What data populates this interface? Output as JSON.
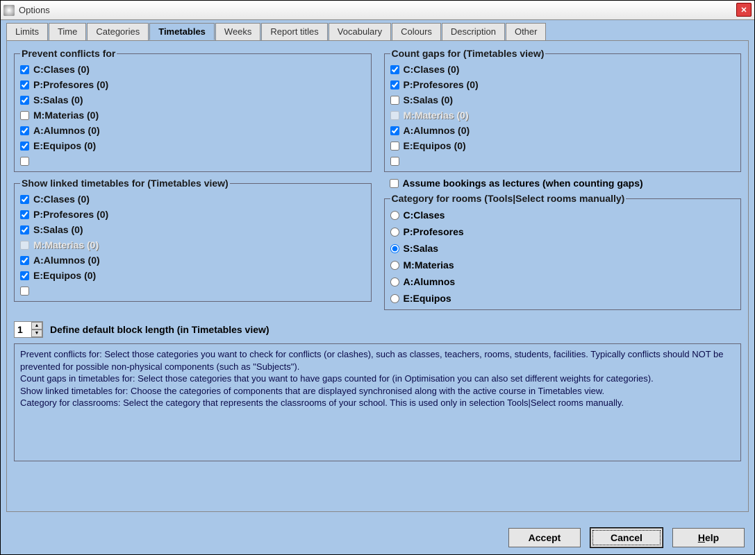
{
  "window": {
    "title": "Options"
  },
  "tabs": [
    "Limits",
    "Time",
    "Categories",
    "Timetables",
    "Weeks",
    "Report titles",
    "Vocabulary",
    "Colours",
    "Description",
    "Other"
  ],
  "active_tab": "Timetables",
  "groups": {
    "prevent": {
      "legend": "Prevent conflicts for",
      "items": [
        {
          "label": "C:Clases (0)",
          "checked": true,
          "disabled": false
        },
        {
          "label": "P:Profesores (0)",
          "checked": true,
          "disabled": false
        },
        {
          "label": "S:Salas (0)",
          "checked": true,
          "disabled": false
        },
        {
          "label": "M:Materias (0)",
          "checked": false,
          "disabled": false
        },
        {
          "label": "A:Alumnos (0)",
          "checked": true,
          "disabled": false
        },
        {
          "label": "E:Equipos (0)",
          "checked": true,
          "disabled": false
        },
        {
          "label": "",
          "checked": false,
          "disabled": false
        }
      ]
    },
    "show_linked": {
      "legend": "Show linked timetables for (Timetables view)",
      "items": [
        {
          "label": "C:Clases (0)",
          "checked": true,
          "disabled": false
        },
        {
          "label": "P:Profesores (0)",
          "checked": true,
          "disabled": false
        },
        {
          "label": "S:Salas (0)",
          "checked": true,
          "disabled": false
        },
        {
          "label": "M:Materias (0)",
          "checked": false,
          "disabled": true
        },
        {
          "label": "A:Alumnos (0)",
          "checked": true,
          "disabled": false
        },
        {
          "label": "E:Equipos (0)",
          "checked": true,
          "disabled": false
        },
        {
          "label": "",
          "checked": false,
          "disabled": false
        }
      ]
    },
    "count_gaps": {
      "legend": "Count gaps for (Timetables view)",
      "items": [
        {
          "label": "C:Clases (0)",
          "checked": true,
          "disabled": false
        },
        {
          "label": "P:Profesores (0)",
          "checked": true,
          "disabled": false
        },
        {
          "label": "S:Salas (0)",
          "checked": false,
          "disabled": false
        },
        {
          "label": "M:Materias (0)",
          "checked": false,
          "disabled": true
        },
        {
          "label": "A:Alumnos (0)",
          "checked": true,
          "disabled": false
        },
        {
          "label": "E:Equipos (0)",
          "checked": false,
          "disabled": false
        },
        {
          "label": "",
          "checked": false,
          "disabled": false
        }
      ]
    },
    "category_rooms": {
      "legend": "Category for rooms (Tools|Select rooms manually)",
      "selected": 2,
      "items": [
        "C:Clases",
        "P:Profesores",
        "S:Salas",
        "M:Materias",
        "A:Alumnos",
        "E:Equipos"
      ]
    }
  },
  "assume_bookings": {
    "label": "Assume bookings as lectures (when counting gaps)",
    "checked": false
  },
  "spinner": {
    "value": "1",
    "label": "Define default block length (in Timetables view)"
  },
  "help_text": "Prevent conflicts for: Select those categories you want to check for conflicts (or clashes), such as classes, teachers, rooms, students, facilities. Typically conflicts should NOT be prevented for possible non-physical components (such as \"Subjects\").\nCount gaps in timetables for: Select those categories that you want to have gaps counted for (in Optimisation you can also set different weights for categories).\nShow linked timetables for: Choose the categories of components that are displayed synchronised along with the active course in Timetables view.\nCategory for classrooms: Select the category that represents the classrooms of your school. This is used only in selection Tools|Select rooms manually.",
  "buttons": {
    "accept": "Accept",
    "cancel": "Cancel",
    "help": "Help"
  }
}
